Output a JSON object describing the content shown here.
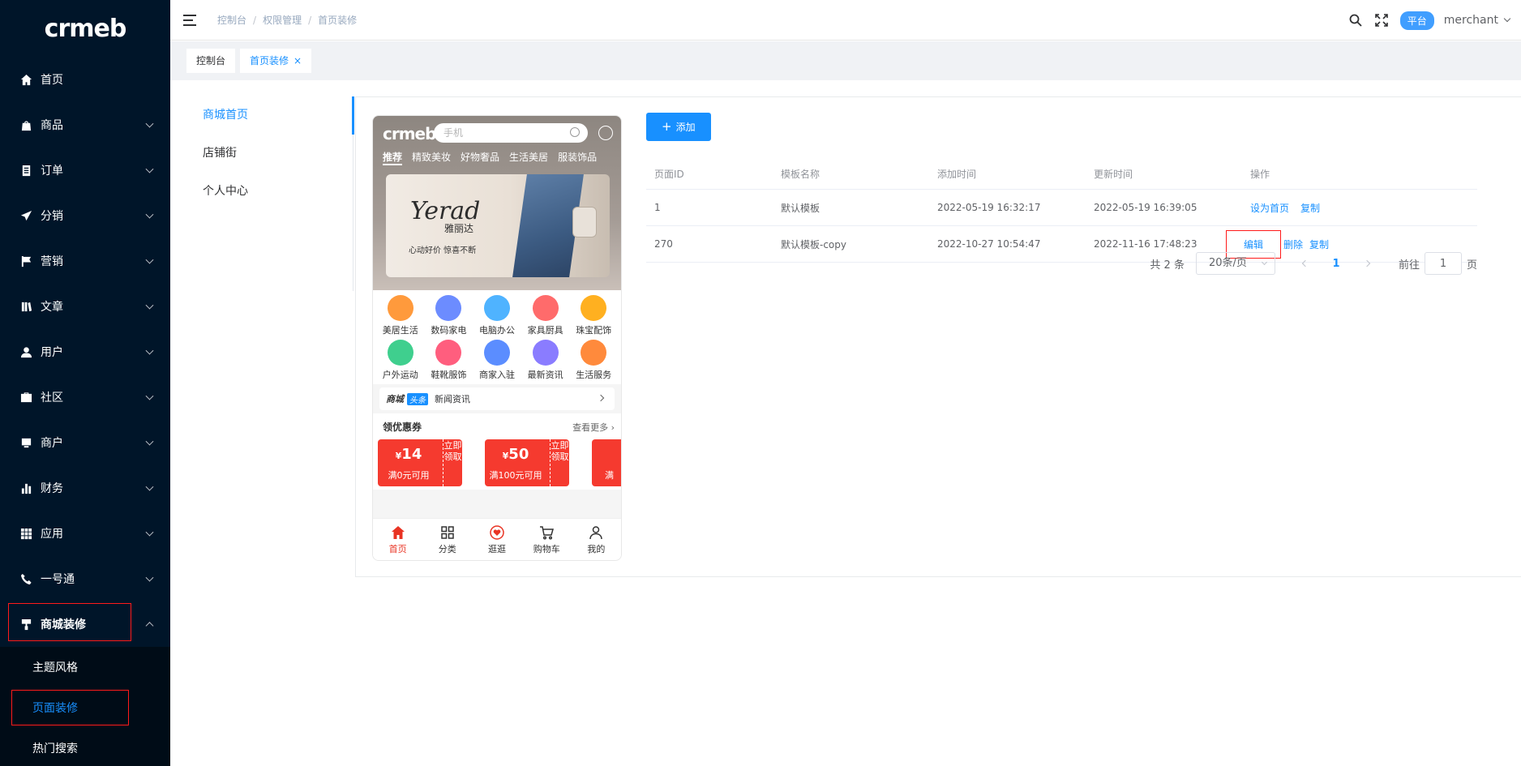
{
  "sidebar": {
    "logo": "crmeb",
    "items": [
      {
        "label": "首页",
        "icon": "home-icon"
      },
      {
        "label": "商品",
        "icon": "shopping-bag-icon"
      },
      {
        "label": "订单",
        "icon": "order-list-icon"
      },
      {
        "label": "分销",
        "icon": "send-icon"
      },
      {
        "label": "营销",
        "icon": "flag-icon"
      },
      {
        "label": "文章",
        "icon": "article-icon"
      },
      {
        "label": "用户",
        "icon": "user-icon"
      },
      {
        "label": "社区",
        "icon": "briefcase-icon"
      },
      {
        "label": "商户",
        "icon": "store-icon"
      },
      {
        "label": "财务",
        "icon": "bar-chart-icon"
      },
      {
        "label": "应用",
        "icon": "grid-icon"
      },
      {
        "label": "一号通",
        "icon": "phone-icon"
      },
      {
        "label": "商城装修",
        "icon": "brush-icon"
      }
    ],
    "submenu": [
      {
        "label": "主题风格"
      },
      {
        "label": "页面装修"
      },
      {
        "label": "热门搜索"
      }
    ]
  },
  "header": {
    "breadcrumb": [
      "控制台",
      "权限管理",
      "首页装修"
    ],
    "role_badge": "平台",
    "username": "merchant"
  },
  "tags": [
    {
      "label": "控制台"
    },
    {
      "label": "首页装修"
    }
  ],
  "leftnav": [
    "商城首页",
    "店铺街",
    "个人中心"
  ],
  "preview": {
    "logo": "crmeb",
    "search_placeholder": "手机",
    "tabs": [
      "推荐",
      "精致美妆",
      "好物奢品",
      "生活美居",
      "服装饰品"
    ],
    "banner_brand": "Yerad",
    "banner_brand_cn": "雅丽达",
    "banner_slogan": "心动好价 惊喜不断",
    "icons": [
      {
        "label": "美居生活",
        "color": "#ff9a3c"
      },
      {
        "label": "数码家电",
        "color": "#6c8cff"
      },
      {
        "label": "电脑办公",
        "color": "#4fb3ff"
      },
      {
        "label": "家具厨具",
        "color": "#ff6b6b"
      },
      {
        "label": "珠宝配饰",
        "color": "#ffb020"
      },
      {
        "label": "户外运动",
        "color": "#3fcf8e"
      },
      {
        "label": "鞋靴服饰",
        "color": "#ff5e7e"
      },
      {
        "label": "商家入驻",
        "color": "#5b8dff"
      },
      {
        "label": "最新资讯",
        "color": "#8a7cff"
      },
      {
        "label": "生活服务",
        "color": "#ff8a3c"
      }
    ],
    "news_logo": "商城",
    "news_tag": "头条",
    "news_text": "新闻资讯",
    "coupon_title": "领优惠券",
    "coupon_more": "查看更多",
    "coupons": [
      {
        "currency": "¥",
        "amount": "14",
        "condition": "满0元可用",
        "action": "立即领取"
      },
      {
        "currency": "¥",
        "amount": "50",
        "condition": "满100元可用",
        "action": "立即领取"
      },
      {
        "currency": "¥",
        "amount": "",
        "condition": "满",
        "action": ""
      }
    ],
    "bottom_nav": [
      "首页",
      "分类",
      "逛逛",
      "购物车",
      "我的"
    ]
  },
  "toolbar": {
    "add_label": "添加"
  },
  "table": {
    "headers": [
      "页面ID",
      "模板名称",
      "添加时间",
      "更新时间",
      "操作"
    ],
    "rows": [
      {
        "id": "1",
        "name": "默认模板",
        "created": "2022-05-19 16:32:17",
        "updated": "2022-05-19 16:39:05",
        "actions": [
          "设为首页",
          "复制"
        ]
      },
      {
        "id": "270",
        "name": "默认模板-copy",
        "created": "2022-10-27 10:54:47",
        "updated": "2022-11-16 17:48:23",
        "actions": [
          "编辑",
          "删除",
          "复制"
        ]
      }
    ]
  },
  "pagination": {
    "total": "共 2 条",
    "page_size": "20条/页",
    "current": "1",
    "goto_label": "前往",
    "goto_value": "1",
    "page_unit": "页"
  },
  "colors": {
    "sidebar_bg": "#001529",
    "primary": "#1890ff",
    "highlight_border": "#ff1a1a",
    "coupon_red": "#f53a2f"
  }
}
